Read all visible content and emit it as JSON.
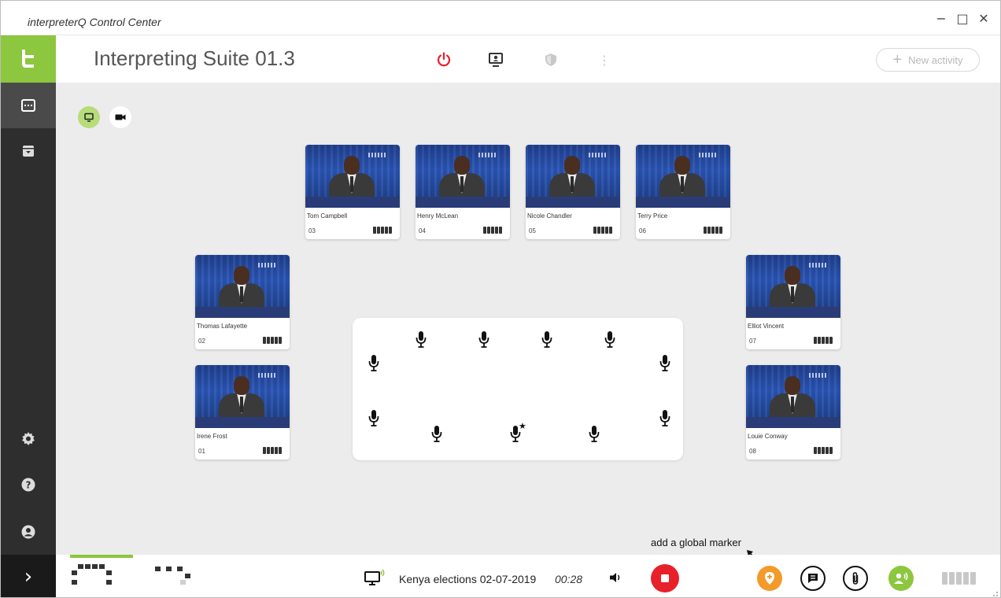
{
  "window": {
    "title": "interpreterQ Control Center",
    "controls": {
      "minimize": "−",
      "maximize": "□",
      "close": "✕"
    }
  },
  "sidebar": {
    "logo": "t",
    "items": [
      "interpreting-console-icon",
      "archive-icon"
    ],
    "bottom_items": [
      "gear-icon",
      "help-icon",
      "user-icon"
    ],
    "expand": "›"
  },
  "header": {
    "title": "Interpreting Suite 01.3",
    "new_activity_label": "New activity",
    "new_activity_plus": "+",
    "more": "⋮"
  },
  "participants": [
    {
      "name": "Tom Campbell",
      "number": "03"
    },
    {
      "name": "Henry McLean",
      "number": "04"
    },
    {
      "name": "Nicole Chandler",
      "number": "05"
    },
    {
      "name": "Terry Price",
      "number": "06"
    },
    {
      "name": "Thomas Lafayette",
      "number": "02"
    },
    {
      "name": "Irene Frost",
      "number": "01"
    },
    {
      "name": "Elliot Vincent",
      "number": "07"
    },
    {
      "name": "Louie Conway",
      "number": "08"
    }
  ],
  "table": {
    "chair_marker": "★"
  },
  "annotation": "add a global marker",
  "footer": {
    "event_title": "Kenya elections 02-07-2019",
    "timer": "00:28"
  },
  "colors": {
    "accent_green": "#8dc63f",
    "record_red": "#e8202a",
    "marker_orange": "#f39a2a",
    "sidebar_dark": "#2e2e2e"
  }
}
